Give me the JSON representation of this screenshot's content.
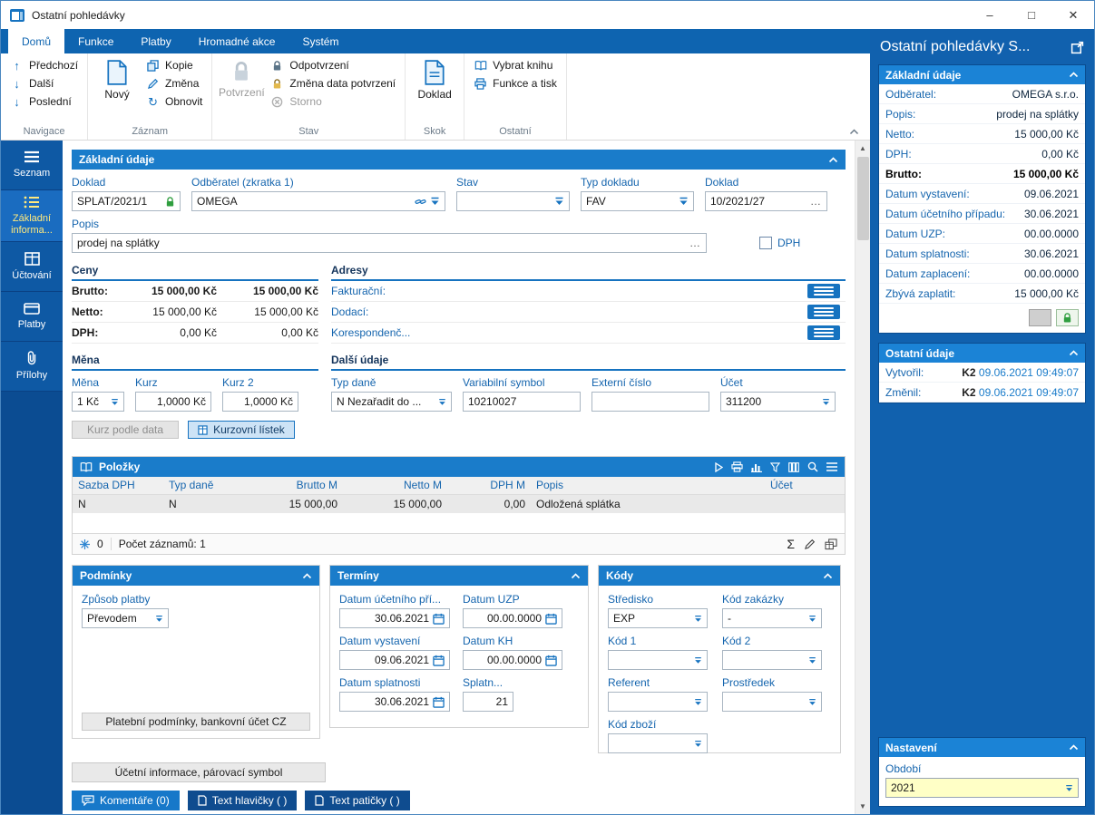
{
  "colors": {
    "ribbon_blue": "#0e64b0",
    "sidebar_blue": "#0b4c92",
    "section_header_blue": "#1a7cca",
    "label_blue": "#1565ae",
    "accent_blue": "#1673c0",
    "active_item_yellow": "#ffe97d",
    "green_lock": "#2f9e3f",
    "period_field_yellow": "#ffffc6"
  },
  "icons": {
    "up_arrow": "↑",
    "down_arrow": "↓",
    "refresh": "↻",
    "sum": "Σ",
    "scroll_up": "▲",
    "scroll_down": "▼"
  },
  "titlebar": {
    "title": "Ostatní pohledávky",
    "minimize": "–",
    "maximize": "□",
    "close": "✕"
  },
  "ribbon": {
    "tabs": [
      {
        "label": "Domů"
      },
      {
        "label": "Funkce"
      },
      {
        "label": "Platby"
      },
      {
        "label": "Hromadné akce"
      },
      {
        "label": "Systém"
      }
    ],
    "nav": {
      "label": "Navigace",
      "items": [
        {
          "label": "Předchozí"
        },
        {
          "label": "Další"
        },
        {
          "label": "Poslední"
        }
      ]
    },
    "zaznam": {
      "label": "Záznam",
      "big": "Nový",
      "items": [
        {
          "label": "Kopie"
        },
        {
          "label": "Změna"
        },
        {
          "label": "Obnovit"
        }
      ]
    },
    "stav": {
      "label": "Stav",
      "big": "Potvrzení",
      "items": [
        {
          "label": "Odpotvrzení"
        },
        {
          "label": "Změna data potvrzení"
        },
        {
          "label": "Storno"
        }
      ]
    },
    "skok": {
      "label": "Skok",
      "big": "Doklad"
    },
    "ostatni": {
      "label": "Ostatní",
      "items": [
        {
          "label": "Vybrat knihu"
        },
        {
          "label": "Funkce a tisk"
        }
      ]
    }
  },
  "sidebar": {
    "items": [
      {
        "label": "Seznam"
      },
      {
        "label": "Základní informa..."
      },
      {
        "label": "Účtování"
      },
      {
        "label": "Platby"
      },
      {
        "label": "Přílohy"
      }
    ]
  },
  "form": {
    "section_title": "Základní údaje",
    "doklad": {
      "label": "Doklad",
      "value": "SPLAT/2021/1"
    },
    "odberatel": {
      "label": "Odběratel (zkratka 1)",
      "value": "OMEGA"
    },
    "stav": {
      "label": "Stav",
      "value": ""
    },
    "typ_dokladu": {
      "label": "Typ dokladu",
      "value": "FAV"
    },
    "doklad2": {
      "label": "Doklad",
      "value": "10/2021/27",
      "more": "…"
    },
    "popis": {
      "label": "Popis",
      "value": "prodej na splátky",
      "more": "…"
    },
    "dph": {
      "label": "DPH"
    },
    "ceny": {
      "title": "Ceny",
      "rows": [
        {
          "label": "Brutto:",
          "v1": "15 000,00 Kč",
          "v2": "15 000,00 Kč"
        },
        {
          "label": "Netto:",
          "v1": "15 000,00 Kč",
          "v2": "15 000,00 Kč"
        },
        {
          "label": "DPH:",
          "v1": "0,00 Kč",
          "v2": "0,00 Kč"
        }
      ]
    },
    "adresy": {
      "title": "Adresy",
      "rows": [
        {
          "label": "Fakturační:"
        },
        {
          "label": "Dodací:"
        },
        {
          "label": "Korespondenč..."
        }
      ]
    },
    "mena": {
      "title": "Měna",
      "mena": {
        "label": "Měna",
        "value": "1 Kč"
      },
      "kurz": {
        "label": "Kurz",
        "value": "1,0000 Kč"
      },
      "kurz2": {
        "label": "Kurz 2",
        "value": "1,0000 Kč"
      },
      "btn_kurz_podle_data": "Kurz podle data",
      "btn_kurzovni_listek": "Kurzovní lístek"
    },
    "dalsi": {
      "title": "Další údaje",
      "typ_dane": {
        "label": "Typ daně",
        "value": "N Nezařadit do ..."
      },
      "var_symbol": {
        "label": "Variabilní symbol",
        "value": "10210027"
      },
      "externi_cislo": {
        "label": "Externí číslo",
        "value": ""
      },
      "ucet": {
        "label": "Účet",
        "value": "311200"
      }
    }
  },
  "polozky": {
    "title": "Položky",
    "columns": [
      "Sazba DPH",
      "Typ daně",
      "Brutto M",
      "Netto M",
      "DPH M",
      "Popis",
      "Účet"
    ],
    "row": [
      "N",
      "N",
      "15 000,00",
      "15 000,00",
      "0,00",
      "Odložená splátka",
      ""
    ],
    "footer": {
      "flag_count": "0",
      "records": "Počet záznamů: 1"
    }
  },
  "podminky": {
    "title": "Podmínky",
    "zpusob_platby": {
      "label": "Způsob platby",
      "value": "Převodem"
    },
    "button": "Platební podmínky, bankovní účet CZ"
  },
  "terminy": {
    "title": "Termíny",
    "ducp": {
      "label": "Datum účetního pří...",
      "value": "30.06.2021"
    },
    "duzp": {
      "label": "Datum UZP",
      "value": "00.00.0000"
    },
    "dvyst": {
      "label": "Datum vystavení",
      "value": "09.06.2021"
    },
    "dkh": {
      "label": "Datum KH",
      "value": "00.00.0000"
    },
    "dspl": {
      "label": "Datum splatnosti",
      "value": "30.06.2021"
    },
    "splatn": {
      "label": "Splatn...",
      "value": "21"
    }
  },
  "kody": {
    "title": "Kódy",
    "stredisko": {
      "label": "Středisko",
      "value": "EXP"
    },
    "kod_zakazky": {
      "label": "Kód zakázky",
      "value": "-"
    },
    "kod1": {
      "label": "Kód 1",
      "value": ""
    },
    "kod2": {
      "label": "Kód 2",
      "value": ""
    },
    "referent": {
      "label": "Referent",
      "value": ""
    },
    "prostredek": {
      "label": "Prostředek",
      "value": ""
    },
    "kod_zbozi": {
      "label": "Kód zboží",
      "value": ""
    }
  },
  "bottom": {
    "ucetni_info": "Účetní informace, párovací symbol",
    "komentare": "Komentáře (0)",
    "text_hlavicky": "Text hlavičky ( )",
    "text_paticky": "Text patičky ( )"
  },
  "panel": {
    "title": "Ostatní pohledávky S...",
    "zakladni": {
      "title": "Základní údaje",
      "rows": [
        {
          "label": "Odběratel:",
          "value": "OMEGA s.r.o."
        },
        {
          "label": "Popis:",
          "value": "prodej na splátky"
        },
        {
          "label": "Netto:",
          "value": "15 000,00 Kč"
        },
        {
          "label": "DPH:",
          "value": "0,00 Kč"
        },
        {
          "label": "Brutto:",
          "value": "15 000,00 Kč"
        },
        {
          "label": "Datum vystavení:",
          "value": "09.06.2021"
        },
        {
          "label": "Datum účetního případu:",
          "value": "30.06.2021"
        },
        {
          "label": "Datum UZP:",
          "value": "00.00.0000"
        },
        {
          "label": "Datum splatnosti:",
          "value": "30.06.2021"
        },
        {
          "label": "Datum zaplacení:",
          "value": "00.00.0000"
        },
        {
          "label": "Zbývá zaplatit:",
          "value": "15 000,00 Kč"
        }
      ]
    },
    "ostatni": {
      "title": "Ostatní údaje",
      "rows": [
        {
          "label": "Vytvořil:",
          "user": "K2",
          "value": "09.06.2021 09:49:07"
        },
        {
          "label": "Změnil:",
          "user": "K2",
          "value": "09.06.2021 09:49:07"
        }
      ]
    },
    "nastaveni": {
      "title": "Nastavení",
      "obdobi": {
        "label": "Období",
        "value": "2021"
      }
    }
  }
}
